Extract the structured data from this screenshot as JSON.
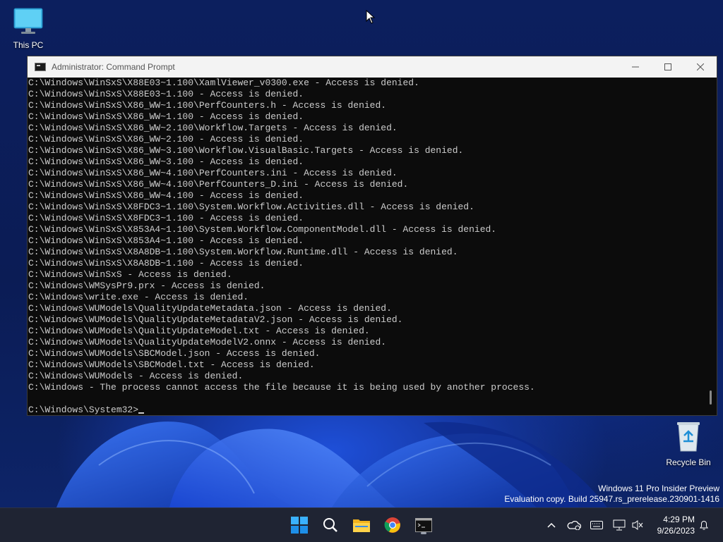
{
  "desktop": {
    "this_pc_label": "This PC",
    "recycle_bin_label": "Recycle Bin"
  },
  "window": {
    "title": "Administrator: Command Prompt",
    "minimize_icon": "minimize-icon",
    "maximize_icon": "maximize-icon",
    "close_icon": "close-icon"
  },
  "console": {
    "lines": [
      "C:\\Windows\\WinSxS\\X88E03~1.100\\XamlViewer_v0300.exe - Access is denied.",
      "C:\\Windows\\WinSxS\\X88E03~1.100 - Access is denied.",
      "C:\\Windows\\WinSxS\\X86_WW~1.100\\PerfCounters.h - Access is denied.",
      "C:\\Windows\\WinSxS\\X86_WW~1.100 - Access is denied.",
      "C:\\Windows\\WinSxS\\X86_WW~2.100\\Workflow.Targets - Access is denied.",
      "C:\\Windows\\WinSxS\\X86_WW~2.100 - Access is denied.",
      "C:\\Windows\\WinSxS\\X86_WW~3.100\\Workflow.VisualBasic.Targets - Access is denied.",
      "C:\\Windows\\WinSxS\\X86_WW~3.100 - Access is denied.",
      "C:\\Windows\\WinSxS\\X86_WW~4.100\\PerfCounters.ini - Access is denied.",
      "C:\\Windows\\WinSxS\\X86_WW~4.100\\PerfCounters_D.ini - Access is denied.",
      "C:\\Windows\\WinSxS\\X86_WW~4.100 - Access is denied.",
      "C:\\Windows\\WinSxS\\X8FDC3~1.100\\System.Workflow.Activities.dll - Access is denied.",
      "C:\\Windows\\WinSxS\\X8FDC3~1.100 - Access is denied.",
      "C:\\Windows\\WinSxS\\X853A4~1.100\\System.Workflow.ComponentModel.dll - Access is denied.",
      "C:\\Windows\\WinSxS\\X853A4~1.100 - Access is denied.",
      "C:\\Windows\\WinSxS\\X8A8DB~1.100\\System.Workflow.Runtime.dll - Access is denied.",
      "C:\\Windows\\WinSxS\\X8A8DB~1.100 - Access is denied.",
      "C:\\Windows\\WinSxS - Access is denied.",
      "C:\\Windows\\WMSysPr9.prx - Access is denied.",
      "C:\\Windows\\write.exe - Access is denied.",
      "C:\\Windows\\WUModels\\QualityUpdateMetadata.json - Access is denied.",
      "C:\\Windows\\WUModels\\QualityUpdateMetadataV2.json - Access is denied.",
      "C:\\Windows\\WUModels\\QualityUpdateModel.txt - Access is denied.",
      "C:\\Windows\\WUModels\\QualityUpdateModelV2.onnx - Access is denied.",
      "C:\\Windows\\WUModels\\SBCModel.json - Access is denied.",
      "C:\\Windows\\WUModels\\SBCModel.txt - Access is denied.",
      "C:\\Windows\\WUModels - Access is denied.",
      "C:\\Windows - The process cannot access the file because it is being used by another process.",
      ""
    ],
    "prompt": "C:\\Windows\\System32>"
  },
  "watermark": {
    "line1": "Windows 11 Pro Insider Preview",
    "line2": "Evaluation copy. Build 25947.rs_prerelease.230901-1416"
  },
  "taskbar": {
    "apps": [
      "windows-start-icon",
      "search-icon",
      "file-explorer-icon",
      "chrome-icon",
      "command-prompt-icon"
    ],
    "tray_icons": [
      "chevron-up-icon",
      "onedrive-icon",
      "keyboard-icon",
      "network-icon",
      "volume-muted-icon",
      "notification-bell-icon"
    ],
    "time": "4:29 PM",
    "date": "9/26/2023"
  }
}
